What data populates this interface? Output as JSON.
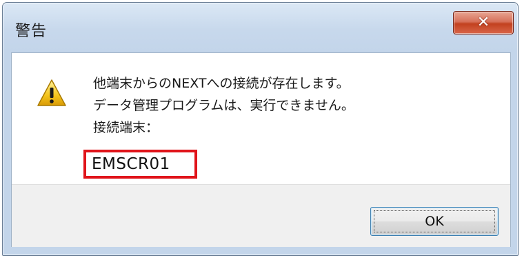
{
  "dialog": {
    "title": "警告",
    "close_icon": "close-icon",
    "icon": "warning-icon",
    "message_lines": [
      "他端末からのNEXTへの接続が存在します。",
      "データ管理プログラムは、実行できません。",
      "接続端末："
    ],
    "terminal_name": "EMSCR01",
    "ok_label": "OK"
  },
  "colors": {
    "highlight_border": "#e0141a",
    "close_button": "#c2411f",
    "title_bar": "#c7d8ec"
  }
}
